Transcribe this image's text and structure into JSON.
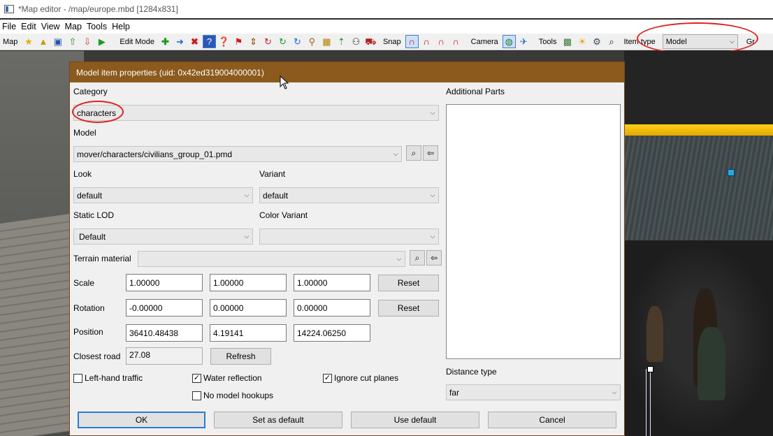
{
  "window": {
    "title": "*Map editor - /map/europe.mbd [1284x831]"
  },
  "menubar": {
    "items": [
      "File",
      "Edit",
      "View",
      "Map",
      "Tools",
      "Help"
    ]
  },
  "toolbar": {
    "map_label": "Map",
    "edit_mode_label": "Edit Mode",
    "snap_label": "Snap",
    "camera_label": "Camera",
    "tools_label": "Tools",
    "item_type_label": "Item type",
    "item_type_value": "Model",
    "overflow_label": "Gr"
  },
  "dialog": {
    "title": "Model item properties (uid: 0x42ed319004000001)",
    "category_label": "Category",
    "category_value": "characters",
    "model_label": "Model",
    "model_value": "mover/characters/civilians_group_01.pmd",
    "look_label": "Look",
    "look_value": "default",
    "variant_label": "Variant",
    "variant_value": "default",
    "static_lod_label": "Static LOD",
    "static_lod_value": "Default",
    "color_variant_label": "Color Variant",
    "color_variant_value": "",
    "terrain_material_label": "Terrain material",
    "terrain_material_value": "",
    "scale_label": "Scale",
    "scale": [
      "1.00000",
      "1.00000",
      "1.00000"
    ],
    "rotation_label": "Rotation",
    "rotation": [
      "-0.00000",
      "0.00000",
      "0.00000"
    ],
    "position_label": "Position",
    "position": [
      "36410.48438",
      "4.19141",
      "14224.06250"
    ],
    "closest_road_label": "Closest road",
    "closest_road_value": "27.08",
    "reset_label": "Reset",
    "refresh_label": "Refresh",
    "additional_parts_label": "Additional Parts",
    "distance_type_label": "Distance type",
    "distance_type_value": "far",
    "checkboxes": {
      "left_hand_traffic": {
        "label": "Left-hand traffic",
        "checked": false
      },
      "water_reflection": {
        "label": "Water reflection",
        "checked": true
      },
      "ignore_cut_planes": {
        "label": "Ignore cut planes",
        "checked": true
      },
      "no_model_hookups": {
        "label": "No model hookups",
        "checked": false
      }
    },
    "buttons": {
      "ok": "OK",
      "set_default": "Set as default",
      "use_default": "Use default",
      "cancel": "Cancel"
    }
  }
}
